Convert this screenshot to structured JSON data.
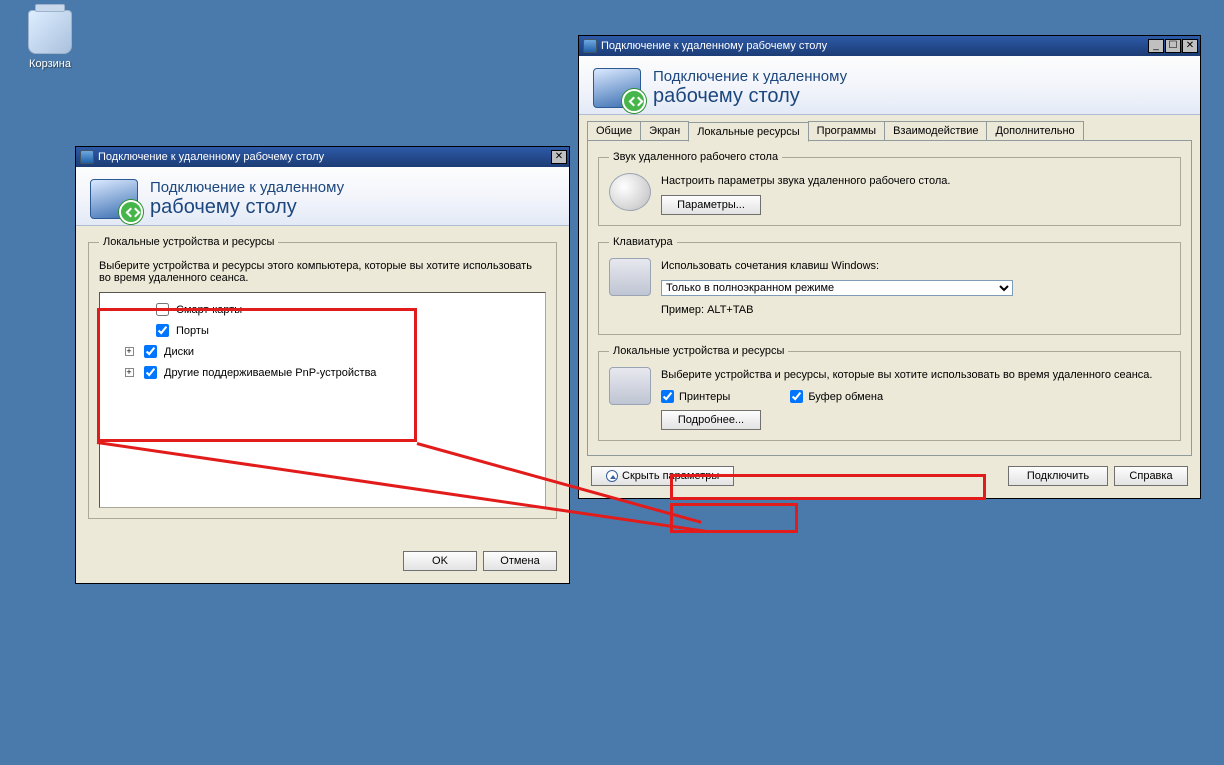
{
  "colors": {
    "annotation": "#e21b1b"
  },
  "desktop": {
    "recycle_bin_label": "Корзина"
  },
  "dialog_left": {
    "title": "Подключение к удаленному рабочему столу",
    "banner_line1": "Подключение к удаленному",
    "banner_line2": "рабочему столу",
    "group_title": "Локальные устройства и ресурсы",
    "description": "Выберите устройства и ресурсы этого компьютера, которые вы хотите использовать во время удаленного сеанса.",
    "devices": [
      {
        "label": "Смарт-карты",
        "checked": false,
        "expandable": false
      },
      {
        "label": "Порты",
        "checked": true,
        "expandable": false
      },
      {
        "label": "Диски",
        "checked": true,
        "expandable": true
      },
      {
        "label": "Другие поддерживаемые PnP-устройства",
        "checked": true,
        "expandable": true
      }
    ],
    "ok_button": "OK",
    "cancel_button": "Отмена"
  },
  "dialog_right": {
    "title": "Подключение к удаленному рабочему столу",
    "banner_line1": "Подключение к удаленному",
    "banner_line2": "рабочему столу",
    "tabs": [
      "Общие",
      "Экран",
      "Локальные ресурсы",
      "Программы",
      "Взаимодействие",
      "Дополнительно"
    ],
    "active_tab_index": 2,
    "audio_group": {
      "legend": "Звук удаленного рабочего стола",
      "text": "Настроить параметры звука удаленного рабочего стола.",
      "button": "Параметры..."
    },
    "keyboard_group": {
      "legend": "Клавиатура",
      "text": "Использовать сочетания клавиш Windows:",
      "combo_value": "Только в полноэкранном режиме",
      "example": "Пример: ALT+TAB"
    },
    "local_group": {
      "legend": "Локальные устройства и ресурсы",
      "text": "Выберите устройства и ресурсы, которые вы хотите использовать во время удаленного сеанса.",
      "printers": {
        "label": "Принтеры",
        "checked": true
      },
      "clipboard": {
        "label": "Буфер обмена",
        "checked": true
      },
      "more_button": "Подробнее..."
    },
    "hide_params_button": "Скрыть параметры",
    "connect_button": "Подключить",
    "help_button": "Справка"
  }
}
